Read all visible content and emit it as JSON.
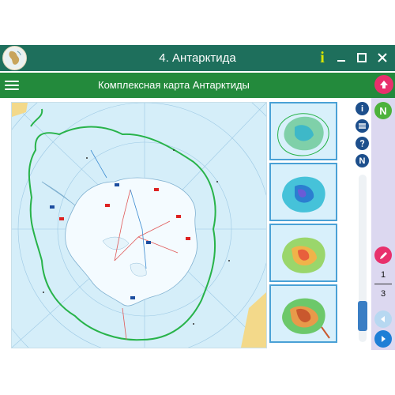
{
  "window": {
    "title": "4. Антарктида",
    "info_label": "i",
    "minimize_label": "–",
    "maximize_label": "☐",
    "close_label": "✕"
  },
  "header": {
    "title": "Комплексная карта Антарктиды"
  },
  "tools": {
    "info_label": "i",
    "north_label": "N"
  },
  "right_panel": {
    "north_label": "N",
    "current_page": "1",
    "total_pages": "3"
  },
  "colors": {
    "titlebar": "#1e6f5c",
    "header": "#238a3c",
    "accent_pink": "#e8306c",
    "accent_green": "#4cb23b",
    "panel": "#dcd8f0",
    "nav_blue": "#1e7fd6"
  },
  "icons": [
    "app-logo-icon",
    "info-icon",
    "minimize-icon",
    "maximize-icon",
    "close-icon",
    "menu-icon",
    "arrow-up-icon",
    "north-icon",
    "layers-icon",
    "help-icon",
    "pen-icon",
    "prev-arrow-icon",
    "next-arrow-icon"
  ]
}
